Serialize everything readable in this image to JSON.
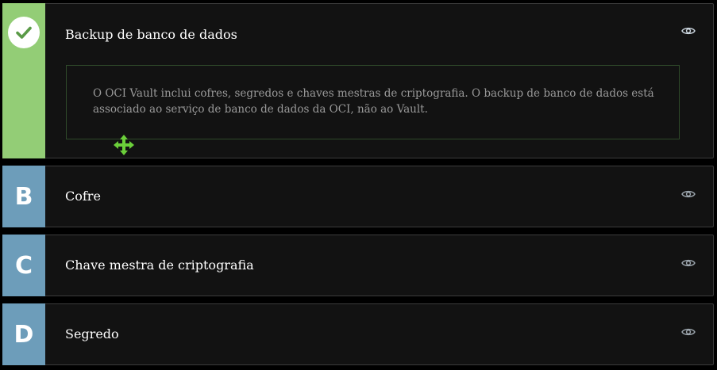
{
  "options": [
    {
      "badge": "",
      "state": "correct",
      "label": "Backup de banco de dados",
      "explanation": "O OCI Vault inclui cofres, segredos e chaves mestras de criptografia. O backup de banco de dados está associado ao serviço de banco de dados da OCI, não ao Vault."
    },
    {
      "badge": "B",
      "state": "normal",
      "label": "Cofre"
    },
    {
      "badge": "C",
      "state": "normal",
      "label": "Chave mestra de criptografia"
    },
    {
      "badge": "D",
      "state": "normal",
      "label": "Segredo"
    }
  ],
  "icons": {
    "correct": "check-icon",
    "reveal": "eye-icon",
    "drag": "move-icon"
  },
  "colors": {
    "correct_badge": "#93cd76",
    "letter_badge": "#6d9dba",
    "check_mark": "#5a9a47",
    "move_handle": "#6bcf3a",
    "eye_active": "#c9d3dc",
    "eye_inactive": "#9aa3ab"
  }
}
